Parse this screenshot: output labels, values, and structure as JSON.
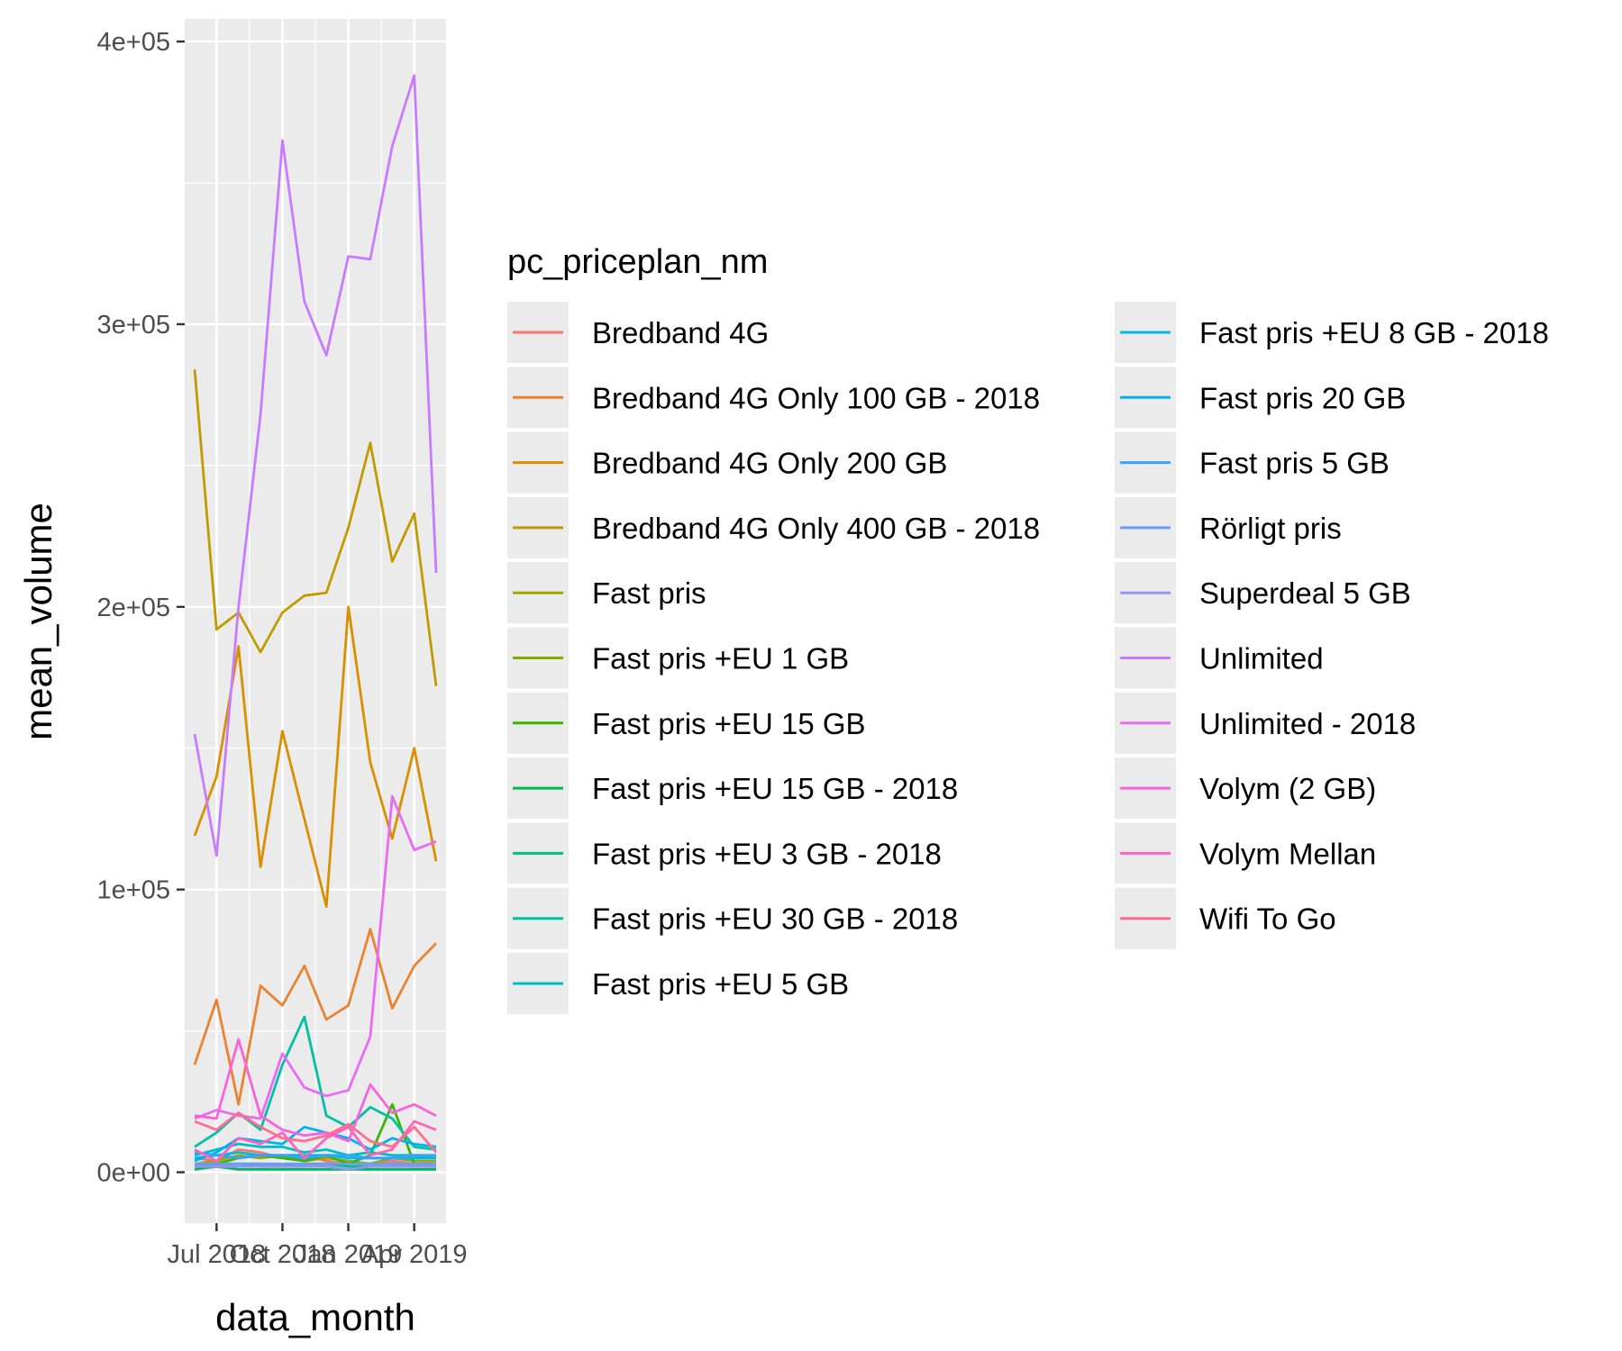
{
  "chart_data": {
    "type": "line",
    "title": "",
    "xlabel": "data_month",
    "ylabel": "mean_volume",
    "x": [
      "2018-06",
      "2018-07",
      "2018-08",
      "2018-09",
      "2018-10",
      "2018-11",
      "2018-12",
      "2019-01",
      "2019-02",
      "2019-03",
      "2019-04",
      "2019-05"
    ],
    "x_tick_labels": [
      {
        "x": "2018-07",
        "label": "Jul 2018"
      },
      {
        "x": "2018-10",
        "label": "Oct 2018"
      },
      {
        "x": "2019-01",
        "label": "Jan 2019"
      },
      {
        "x": "2019-04",
        "label": "Apr 2019"
      }
    ],
    "y_ticks": [
      {
        "value": 0,
        "label": "0e+00"
      },
      {
        "value": 100000,
        "label": "1e+05"
      },
      {
        "value": 200000,
        "label": "2e+05"
      },
      {
        "value": 300000,
        "label": "3e+05"
      },
      {
        "value": 400000,
        "label": "4e+05"
      }
    ],
    "ylim": [
      -18000,
      408000
    ],
    "grid": true,
    "panel_background": "#ebebeb",
    "legend": {
      "title": "pc_priceplan_nm",
      "placement": "right",
      "columns": 2
    },
    "series": [
      {
        "name": "Bredband 4G",
        "color": "#F8766D",
        "values": [
          5000,
          4000,
          8000,
          7000,
          5000,
          6000,
          4000,
          3000,
          3000,
          4000,
          3000,
          3000
        ]
      },
      {
        "name": "Bredband 4G Only 100 GB - 2018",
        "color": "#EA8331",
        "values": [
          38000,
          61000,
          24000,
          66000,
          59000,
          73000,
          54000,
          59000,
          86000,
          58000,
          73000,
          81000
        ]
      },
      {
        "name": "Bredband 4G Only 200 GB",
        "color": "#D89000",
        "values": [
          119000,
          140000,
          186000,
          108000,
          156000,
          125000,
          94000,
          200000,
          145000,
          118000,
          150000,
          110000
        ]
      },
      {
        "name": "Bredband 4G Only 400 GB - 2018",
        "color": "#C09B00",
        "values": [
          284000,
          192000,
          198000,
          184000,
          198000,
          204000,
          205000,
          228000,
          258000,
          216000,
          233000,
          172000
        ]
      },
      {
        "name": "Fast pris",
        "color": "#A3A500",
        "values": [
          3000,
          4000,
          6000,
          5000,
          6000,
          4000,
          5000,
          4000,
          3000,
          5000,
          4000,
          4000
        ]
      },
      {
        "name": "Fast pris +EU 1 GB",
        "color": "#7CAE00",
        "values": [
          2000,
          2000,
          3000,
          3000,
          2000,
          2000,
          3000,
          2000,
          2000,
          3000,
          2000,
          2000
        ]
      },
      {
        "name": "Fast pris +EU 15 GB",
        "color": "#39B600",
        "values": [
          2000,
          3000,
          5000,
          6000,
          5000,
          4000,
          6000,
          3000,
          6000,
          24000,
          3000,
          3000
        ]
      },
      {
        "name": "Fast pris +EU 15 GB - 2018",
        "color": "#00BB4E",
        "values": [
          1000,
          2000,
          1000,
          1000,
          1000,
          1000,
          1000,
          1000,
          1000,
          1000,
          1000,
          1000
        ]
      },
      {
        "name": "Fast pris +EU 3 GB - 2018",
        "color": "#00BF7D",
        "values": [
          2000,
          3000,
          3000,
          2000,
          2000,
          3000,
          3000,
          2000,
          2000,
          2000,
          2000,
          2000
        ]
      },
      {
        "name": "Fast pris +EU 30 GB - 2018",
        "color": "#00C1A3",
        "values": [
          9000,
          14000,
          21000,
          15000,
          38000,
          55000,
          20000,
          16000,
          23000,
          19000,
          9000,
          8000
        ]
      },
      {
        "name": "Fast pris +EU 5 GB",
        "color": "#00BFC4",
        "values": [
          6000,
          8000,
          10000,
          9000,
          9000,
          7000,
          8000,
          6000,
          7000,
          6000,
          6000,
          5000
        ]
      },
      {
        "name": "Fast pris +EU 8 GB - 2018",
        "color": "#00BAE0",
        "values": [
          5000,
          6000,
          7000,
          6000,
          6000,
          6000,
          6000,
          5000,
          5000,
          5000,
          5000,
          5000
        ]
      },
      {
        "name": "Fast pris 20 GB",
        "color": "#00B0F6",
        "values": [
          4000,
          7000,
          12000,
          11000,
          10000,
          16000,
          14000,
          12000,
          8000,
          12000,
          10000,
          9000
        ]
      },
      {
        "name": "Fast pris 5 GB",
        "color": "#35A2FF",
        "values": [
          7000,
          6000,
          5000,
          6000,
          6000,
          5000,
          6000,
          6000,
          5000,
          5000,
          6000,
          6000
        ]
      },
      {
        "name": "Rörligt pris",
        "color": "#6F9BF8",
        "values": [
          3000,
          3000,
          3000,
          3000,
          3000,
          3000,
          3000,
          3000,
          3000,
          3000,
          3000,
          3000
        ]
      },
      {
        "name": "Superdeal 5 GB",
        "color": "#9590FF",
        "values": [
          2000,
          2000,
          2000,
          2000,
          2000,
          2000,
          2000,
          1000,
          2000,
          2000,
          2000,
          2000
        ]
      },
      {
        "name": "Unlimited",
        "color": "#C77CFF",
        "values": [
          155000,
          112000,
          200000,
          268000,
          365000,
          308000,
          289000,
          324000,
          323000,
          363000,
          388000,
          212000
        ]
      },
      {
        "name": "Unlimited - 2018",
        "color": "#E76BF3",
        "values": [
          19000,
          22000,
          20000,
          19000,
          42000,
          30000,
          27000,
          29000,
          48000,
          133000,
          114000,
          117000
        ]
      },
      {
        "name": "Volym (2 GB)",
        "color": "#FA62DB",
        "values": [
          20000,
          19000,
          47000,
          20000,
          15000,
          13000,
          14000,
          11000,
          31000,
          21000,
          24000,
          20000
        ]
      },
      {
        "name": "Volym Mellan",
        "color": "#FF62BC",
        "values": [
          8000,
          4000,
          12000,
          10000,
          14000,
          5000,
          12000,
          16000,
          6000,
          8000,
          18000,
          15000
        ]
      },
      {
        "name": "Wifi To Go",
        "color": "#FF6C91",
        "values": [
          18000,
          15000,
          21000,
          16000,
          12000,
          11000,
          13000,
          17000,
          11000,
          9000,
          16000,
          7000
        ]
      }
    ]
  }
}
